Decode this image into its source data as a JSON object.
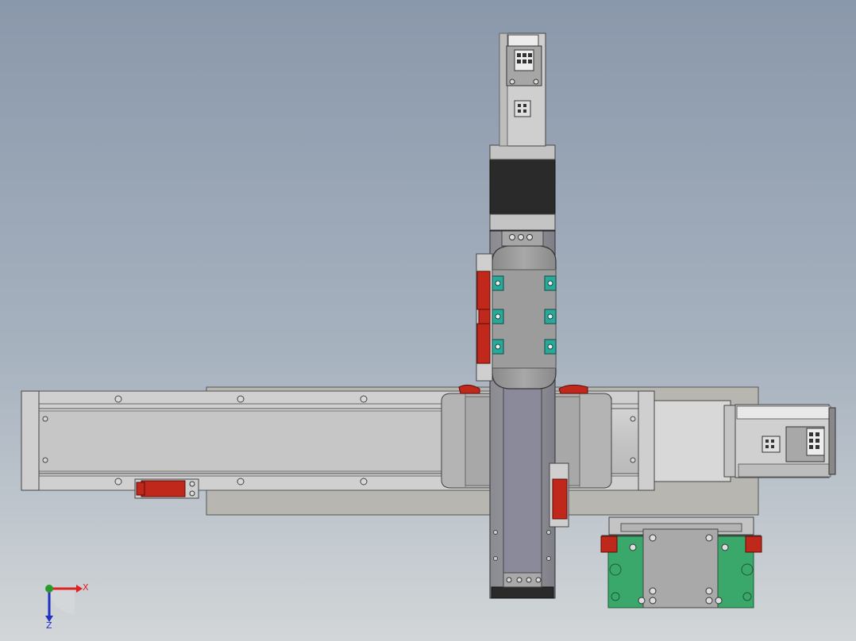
{
  "view": {
    "type": "cad-model-viewport",
    "background_top": "#8a98ab",
    "background_bottom": "#d2d6d8"
  },
  "triad": {
    "x_label": "X",
    "z_label": "Z",
    "x_color": "#e02020",
    "y_color": "#2a9a2a",
    "z_color": "#2030c0"
  },
  "colors": {
    "rail": "#c8c8c8",
    "carriage_grey": "#9a9a9a",
    "motor_black": "#2a2a2a",
    "sensor_red": "#c0281c",
    "mount_green": "#3aa86a",
    "teal_fastener": "#2aa89a"
  }
}
